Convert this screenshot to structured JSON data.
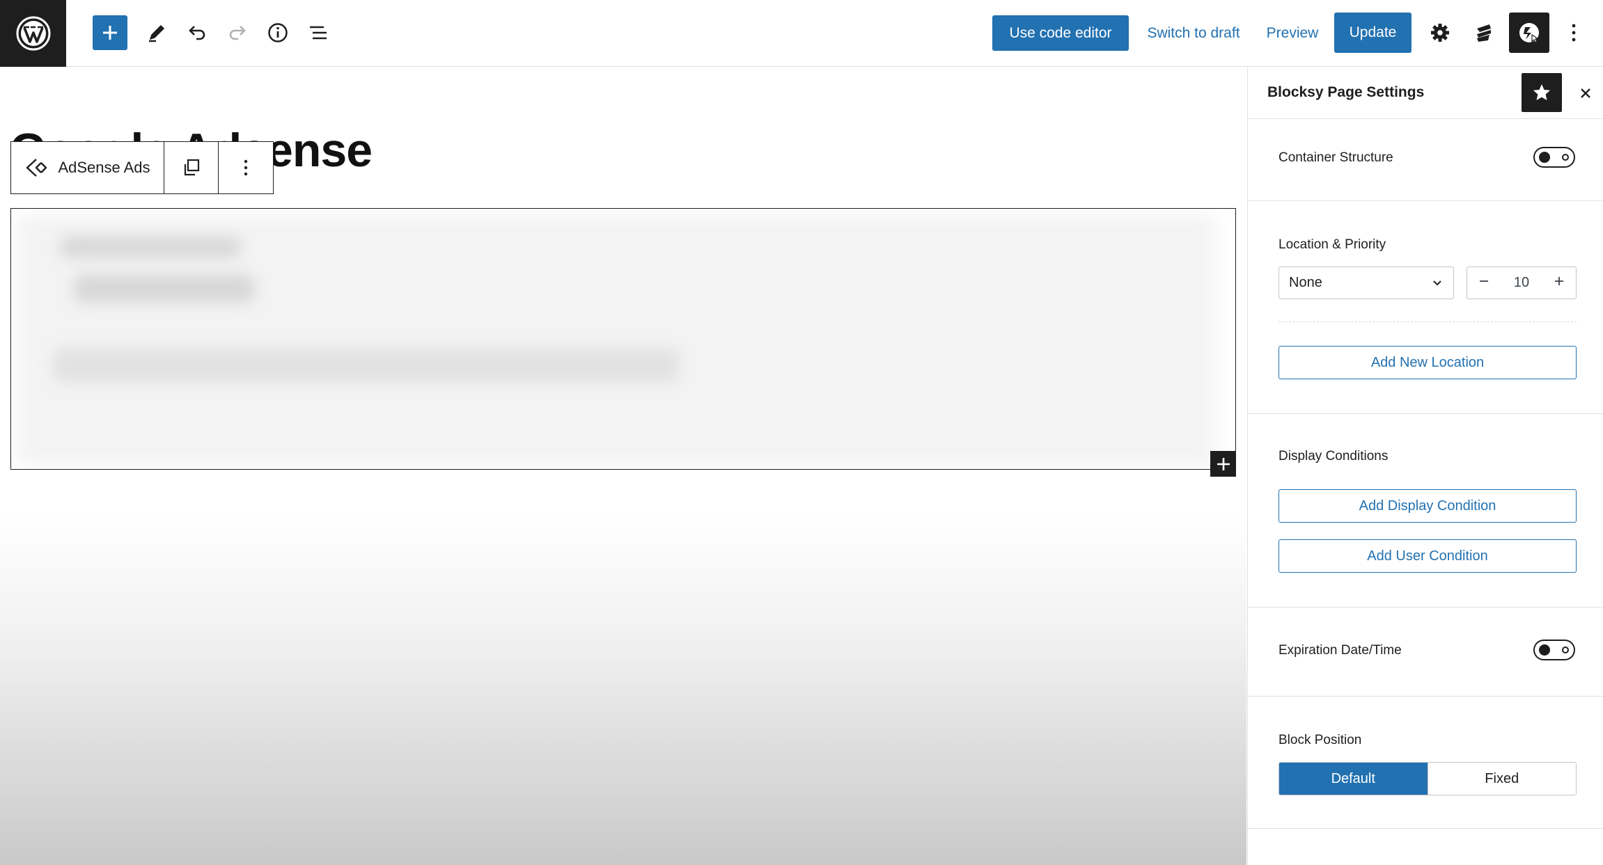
{
  "topbar": {
    "use_code_editor": "Use code editor",
    "switch_to_draft": "Switch to draft",
    "preview": "Preview",
    "update": "Update",
    "icons": [
      "wordpress-logo-icon",
      "plus-icon",
      "pencil-icon",
      "undo-icon",
      "redo-icon",
      "info-icon",
      "list-view-icon",
      "gear-icon",
      "stackable-icon",
      "blocksy-icon",
      "more-vertical-icon"
    ],
    "accent_color": "#2271b1"
  },
  "canvas": {
    "page_title": "Google Adsense",
    "block_toolbar": {
      "block_name": "AdSense Ads"
    }
  },
  "sidebar": {
    "title": "Blocksy Page Settings",
    "container_structure": {
      "label": "Container Structure",
      "enabled": false
    },
    "location_priority": {
      "label": "Location & Priority",
      "location_value": "None",
      "priority_value": "10",
      "add_location": "Add New Location"
    },
    "display_conditions": {
      "label": "Display Conditions",
      "add_display": "Add Display Condition",
      "add_user": "Add User Condition"
    },
    "expiration": {
      "label": "Expiration Date/Time",
      "enabled": false
    },
    "block_position": {
      "label": "Block Position",
      "options": [
        "Default",
        "Fixed"
      ],
      "selected": "Default"
    }
  }
}
